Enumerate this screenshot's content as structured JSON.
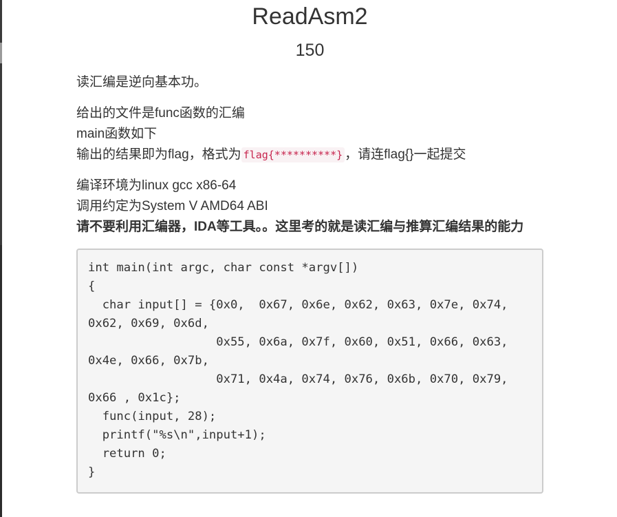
{
  "challenge": {
    "title": "ReadAsm2",
    "points": "150",
    "description": {
      "p1": "读汇编是逆向基本功。",
      "p2_line1": "给出的文件是func函数的汇编",
      "p2_line2": "main函数如下",
      "p2_line3_prefix": "输出的结果即为flag，格式为",
      "p2_line3_code": "flag{**********}",
      "p2_line3_suffix": "，请连flag{}一起提交",
      "p3_line1": "编译环境为linux gcc x86-64",
      "p3_line2": "调用约定为System V AMD64 ABI",
      "p3_bold": "请不要利用汇编器，IDA等工具。。这里考的就是读汇编与推算汇编结果的能力"
    },
    "code_lines": [
      "int main(int argc, char const *argv[])",
      "{",
      "  char input[] = {0x0,  0x67, 0x6e, 0x62, 0x63, 0x7e, 0x74,",
      "0x62, 0x69, 0x6d,",
      "                  0x55, 0x6a, 0x7f, 0x60, 0x51, 0x66, 0x63,",
      "0x4e, 0x66, 0x7b,",
      "                  0x71, 0x4a, 0x74, 0x76, 0x6b, 0x70, 0x79,",
      "0x66 , 0x1c};",
      "  func(input, 28);",
      "  printf(\"%s\\n\",input+1);",
      "  return 0;",
      "}"
    ]
  }
}
